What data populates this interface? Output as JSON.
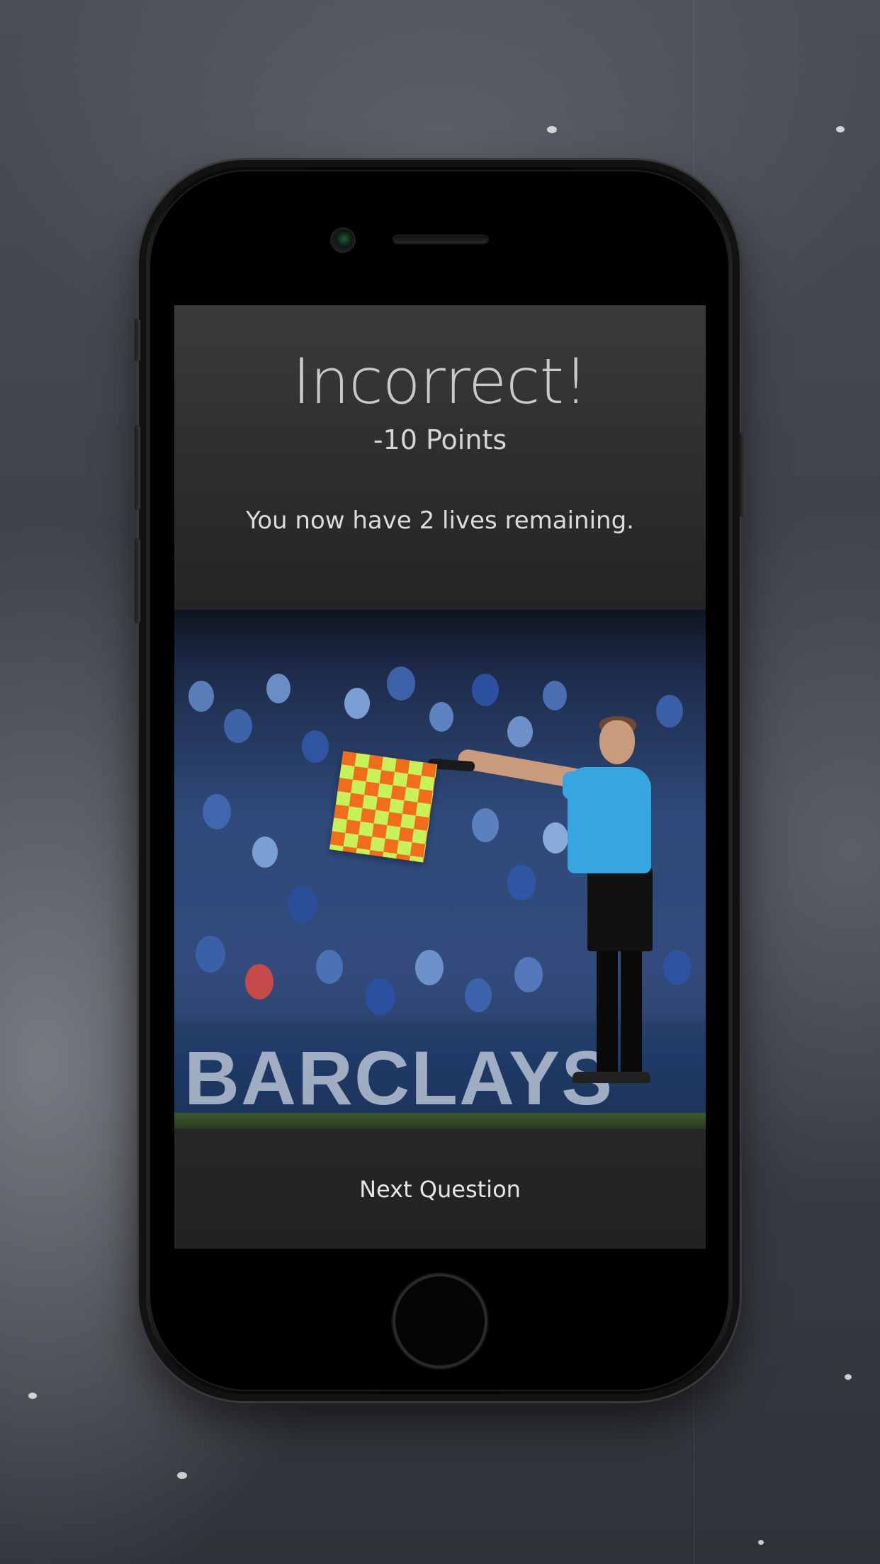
{
  "result": {
    "title": "Incorrect!",
    "points": "-10 Points",
    "lives_message": "You now have 2 lives remaining."
  },
  "image": {
    "board_text": "BARCLAYS",
    "description_icon": "referee-offside-flag-image"
  },
  "actions": {
    "next_label": "Next Question"
  }
}
